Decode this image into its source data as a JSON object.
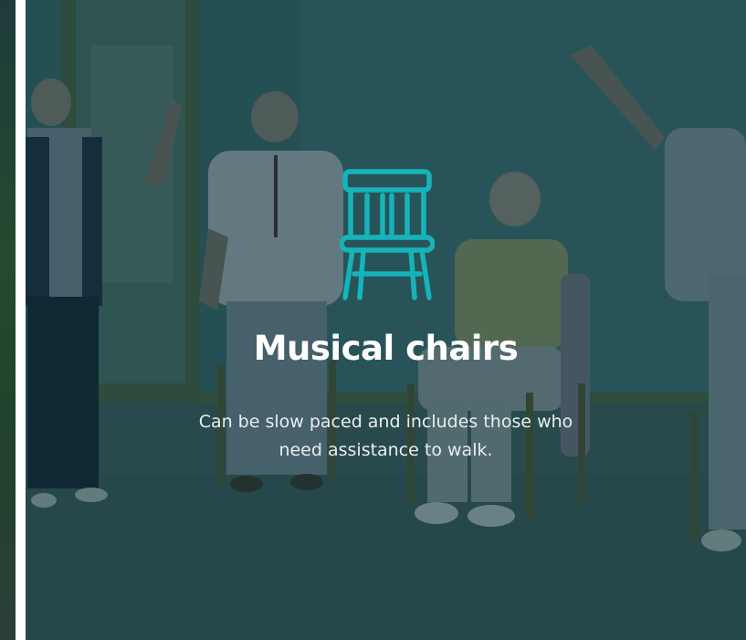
{
  "card": {
    "title": "Musical chairs",
    "description": "Can be slow paced and includes those who need assistance to walk.",
    "icon": "chair-icon",
    "photo_subject": "photo",
    "colors": {
      "accent": "#16b3ba",
      "overlay": "#0e343c",
      "text": "#ffffff"
    }
  }
}
